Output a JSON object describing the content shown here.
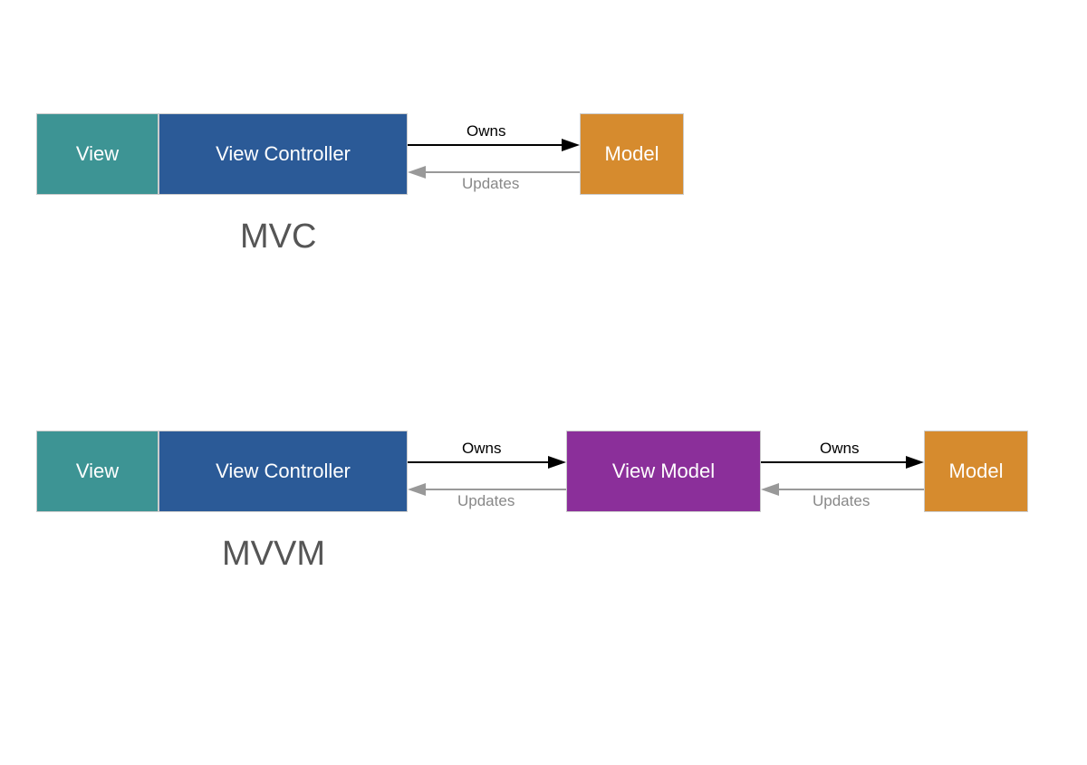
{
  "colors": {
    "teal": "#3d9494",
    "blue": "#2b5a97",
    "purple": "#8b2f9a",
    "orange": "#d68b2e",
    "gray": "#999"
  },
  "labels": {
    "view": "View",
    "viewController": "View Controller",
    "viewModel": "View Model",
    "model": "Model",
    "owns": "Owns",
    "updates": "Updates",
    "mvc": "MVC",
    "mvvm": "MVVM"
  }
}
